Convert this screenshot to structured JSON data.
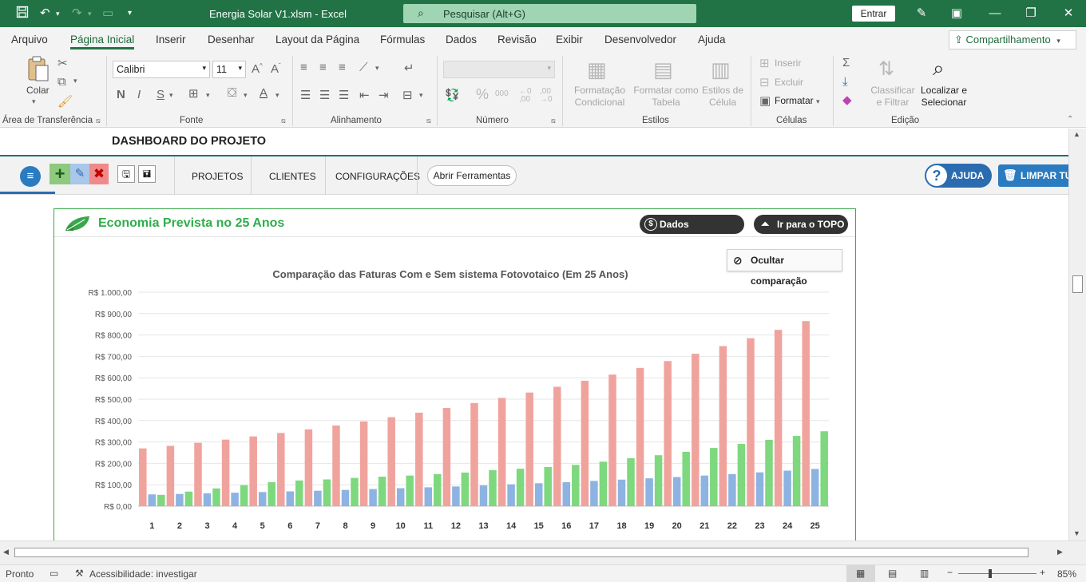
{
  "titlebar": {
    "file_title": "Energia Solar V1.xlsm  -  Excel",
    "search_placeholder": "Pesquisar (Alt+G)",
    "signin_label": "Entrar"
  },
  "menu": {
    "tabs": [
      "Arquivo",
      "Página Inicial",
      "Inserir",
      "Desenhar",
      "Layout da Página",
      "Fórmulas",
      "Dados",
      "Revisão",
      "Exibir",
      "Desenvolvedor",
      "Ajuda"
    ],
    "active": "Página Inicial",
    "share_label": "Compartilhamento"
  },
  "ribbon": {
    "clipboard": {
      "paste_label": "Colar",
      "group_label": "Área de Transferência"
    },
    "font": {
      "font_name": "Calibri",
      "font_size": "11",
      "group_label": "Fonte"
    },
    "alignment": {
      "group_label": "Alinhamento"
    },
    "number": {
      "group_label": "Número",
      "thousands_label": "000",
      "dec_inc_label": "←0 ,00",
      "dec_dec_label": ",00 →0"
    },
    "styles": {
      "cond_format": "Formatação Condicional",
      "format_table": "Formatar como Tabela",
      "cell_styles": "Estilos de Célula",
      "group_label": "Estilos"
    },
    "cells": {
      "insert": "Inserir",
      "delete": "Excluir",
      "format": "Formatar",
      "group_label": "Células"
    },
    "editing": {
      "sort_filter": "Classificar e Filtrar",
      "find_select": "Localizar e Selecionar",
      "group_label": "Edição"
    }
  },
  "dashboard": {
    "title": "DASHBOARD DO PROJETO",
    "nav": [
      "PROJETOS",
      "CLIENTES",
      "CONFIGURAÇÕES"
    ],
    "tools_button": "Abrir Ferramentas",
    "help_button": "AJUDA",
    "clear_button": "LIMPAR TUDO"
  },
  "panel": {
    "title": "Economia Prevista no 25 Anos",
    "financial_button": "Dados Financeiros",
    "top_button": "Ir para o TOPO",
    "hide_button": "Ocultar comparação"
  },
  "chart_data": {
    "type": "bar",
    "title": "Comparação das Faturas Com e Sem sistema Fotovotaico (Em 25 Anos)",
    "categories": [
      "1",
      "2",
      "3",
      "4",
      "5",
      "6",
      "7",
      "8",
      "9",
      "10",
      "11",
      "12",
      "13",
      "14",
      "15",
      "16",
      "17",
      "18",
      "19",
      "20",
      "21",
      "22",
      "23",
      "24",
      "25"
    ],
    "ylim": [
      0,
      1000
    ],
    "yticks": [
      "R$ 0,00",
      "R$ 100,00",
      "R$ 200,00",
      "R$ 300,00",
      "R$ 400,00",
      "R$ 500,00",
      "R$ 600,00",
      "R$ 700,00",
      "R$ 800,00",
      "R$ 900,00",
      "R$ 1.000,00"
    ],
    "grid": true,
    "series": [
      {
        "color": "#f0a39d",
        "values": [
          270,
          282,
          296,
          311,
          326,
          342,
          359,
          377,
          396,
          416,
          437,
          459,
          482,
          506,
          531,
          558,
          586,
          615,
          646,
          678,
          712,
          748,
          785,
          824,
          865
        ]
      },
      {
        "color": "#8db3e2",
        "values": [
          55,
          57,
          60,
          63,
          66,
          69,
          72,
          76,
          80,
          84,
          88,
          92,
          97,
          102,
          107,
          112,
          118,
          124,
          130,
          136,
          143,
          150,
          158,
          166,
          174
        ]
      },
      {
        "color": "#7ed87e",
        "values": [
          53,
          68,
          83,
          98,
          112,
          120,
          125,
          132,
          138,
          143,
          150,
          157,
          168,
          175,
          183,
          193,
          208,
          224,
          238,
          254,
          272,
          291,
          310,
          328,
          350
        ]
      }
    ]
  },
  "status": {
    "ready": "Pronto",
    "accessibility": "Acessibilidade: investigar",
    "zoom": "85%"
  }
}
